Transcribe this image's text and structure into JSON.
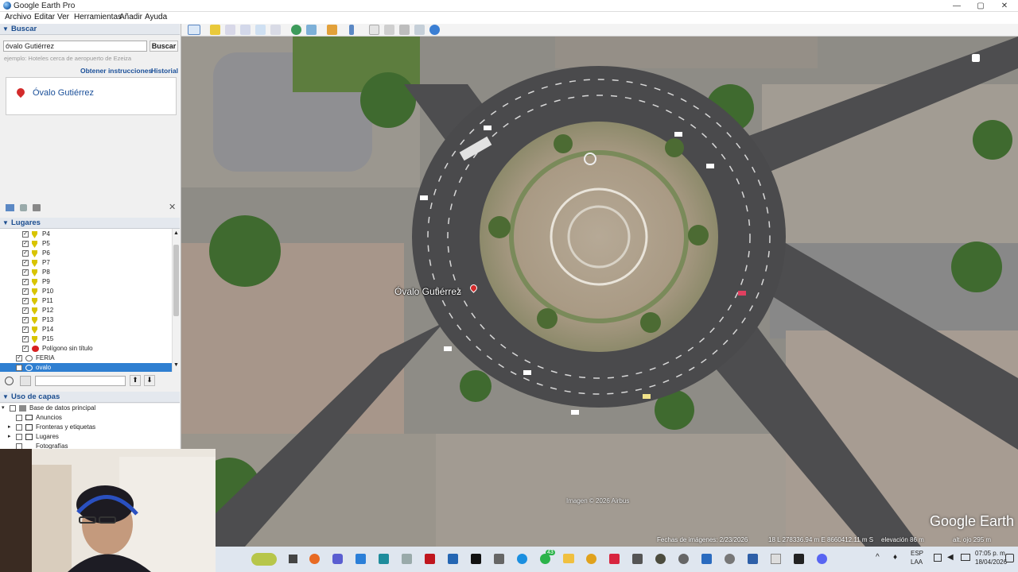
{
  "window": {
    "title": "Google Earth Pro",
    "minimize": "—",
    "maximize": "▢",
    "close": "✕"
  },
  "menu": [
    "Archivo",
    "Editar",
    "Ver",
    "Herramientas",
    "Añadir",
    "Ayuda"
  ],
  "search": {
    "header": "Buscar",
    "value": "óvalo Gutiérrez",
    "button": "Buscar",
    "hint": "ejemplo: Hoteles cerca de aeropuerto de Ezeiza",
    "link_directions": "Obtener instrucciones",
    "link_history": "Historial",
    "result": "Óvalo Gutiérrez"
  },
  "places": {
    "header": "Lugares",
    "items": [
      "P4",
      "P5",
      "P6",
      "P7",
      "P8",
      "P9",
      "P10",
      "P11",
      "P12",
      "P13",
      "P14",
      "P15",
      "Polígono sin título",
      "FERIA",
      "ovalo"
    ]
  },
  "layers": {
    "header": "Uso de capas",
    "items": [
      "Base de datos principal",
      "Anuncios",
      "Fronteras y etiquetas",
      "Lugares",
      "Fotografías"
    ]
  },
  "map": {
    "placemark_label": "Óvalo Gutiérrez",
    "image_credit": "Imagen © 2026 Airbus",
    "brand": "Google Earth",
    "status": {
      "imagery_date": "Fechas de imágenes: 2/23/2026",
      "coords": "18 L 278336.94 m E 8660412.11 m S",
      "elevation": "elevación   86 m",
      "eye_alt": "alt. ojo   295 m"
    }
  },
  "taskbar": {
    "lang": "ESP",
    "lang2": "LAA",
    "time": "07:05 p. m.",
    "date": "18/04/2026",
    "badge": "43"
  },
  "colors": {
    "accent": "#2f7fd1",
    "header_text": "#1b4d8f",
    "link": "#1a4f99",
    "pin": "#d32b2b"
  }
}
